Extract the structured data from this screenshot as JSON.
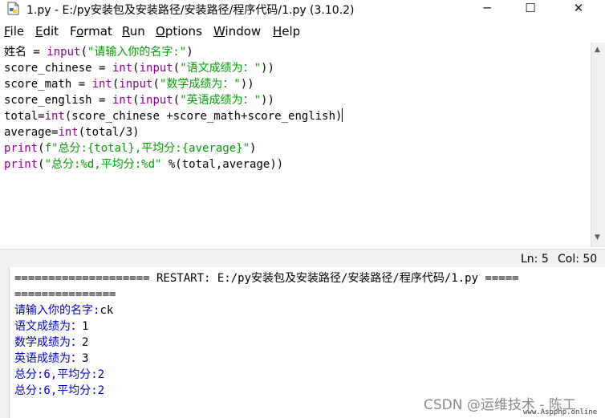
{
  "window": {
    "title": "1.py - E:/py安装包及安装路径/安装路径/程序代码/1.py (3.10.2)",
    "minimize": "─",
    "maximize": "☐",
    "close": "✕"
  },
  "menu": {
    "items": [
      {
        "key": "F",
        "rest": "ile"
      },
      {
        "key": "E",
        "rest": "dit"
      },
      {
        "pre": "F",
        "key": "o",
        "rest": "rmat"
      },
      {
        "key": "R",
        "rest": "un"
      },
      {
        "key": "O",
        "rest": "ptions"
      },
      {
        "key": "W",
        "rest": "indow"
      },
      {
        "key": "H",
        "rest": "elp"
      }
    ]
  },
  "editor": {
    "lines": [
      [
        [
          "n",
          "姓名 = "
        ],
        [
          "k",
          "input"
        ],
        [
          "n",
          "("
        ],
        [
          "s",
          "\"请输入你的名字:\""
        ],
        [
          "n",
          ")"
        ]
      ],
      [
        [
          "n",
          "score_chinese = "
        ],
        [
          "k",
          "int"
        ],
        [
          "n",
          "("
        ],
        [
          "k",
          "input"
        ],
        [
          "n",
          "("
        ],
        [
          "s",
          "\"语文成绩为：\""
        ],
        [
          "n",
          "))"
        ]
      ],
      [
        [
          "n",
          "score_math = "
        ],
        [
          "k",
          "int"
        ],
        [
          "n",
          "("
        ],
        [
          "k",
          "input"
        ],
        [
          "n",
          "("
        ],
        [
          "s",
          "\"数学成绩为：\""
        ],
        [
          "n",
          "))"
        ]
      ],
      [
        [
          "n",
          "score_english = "
        ],
        [
          "k",
          "int"
        ],
        [
          "n",
          "("
        ],
        [
          "k",
          "input"
        ],
        [
          "n",
          "("
        ],
        [
          "s",
          "\"英语成绩为：\""
        ],
        [
          "n",
          "))"
        ]
      ],
      [
        [
          "n",
          "total="
        ],
        [
          "k",
          "int"
        ],
        [
          "n",
          "(score_chinese +score_math+score_english)"
        ]
      ],
      [
        [
          "n",
          "average="
        ],
        [
          "k",
          "int"
        ],
        [
          "n",
          "(total/3)"
        ]
      ],
      [
        [
          "k",
          "print"
        ],
        [
          "n",
          "("
        ],
        [
          "s",
          "f\"总分:{total},平均分:{average}\""
        ],
        [
          "n",
          ")"
        ]
      ],
      [
        [
          "k",
          "print"
        ],
        [
          "n",
          "("
        ],
        [
          "s",
          "\"总分:%d,平均分:%d\""
        ],
        [
          "n",
          " %(total,average))"
        ]
      ]
    ]
  },
  "status": {
    "line": "Ln: 5",
    "col": "Col: 50"
  },
  "shell": {
    "restart_line": "==================== RESTART: E:/py安装包及安装路径/安装路径/程序代码/1.py =====",
    "restart_cont": "===============",
    "lines": [
      {
        "prompt": "请输入你的名字:",
        "answer": "ck"
      },
      {
        "prompt": "语文成绩为：",
        "answer": "1"
      },
      {
        "prompt": "数学成绩为：",
        "answer": "2"
      },
      {
        "prompt": "英语成绩为：",
        "answer": "3"
      }
    ],
    "outputs": [
      "总分:6,平均分:2",
      "总分:6,平均分:2"
    ]
  },
  "watermark": {
    "csdn": "CSDN @运维技术 - 陈工",
    "site": "www.Aspphp.online"
  },
  "colors": {
    "keyword": "#900090",
    "string": "#00a000",
    "shell_output": "#0000c0"
  }
}
